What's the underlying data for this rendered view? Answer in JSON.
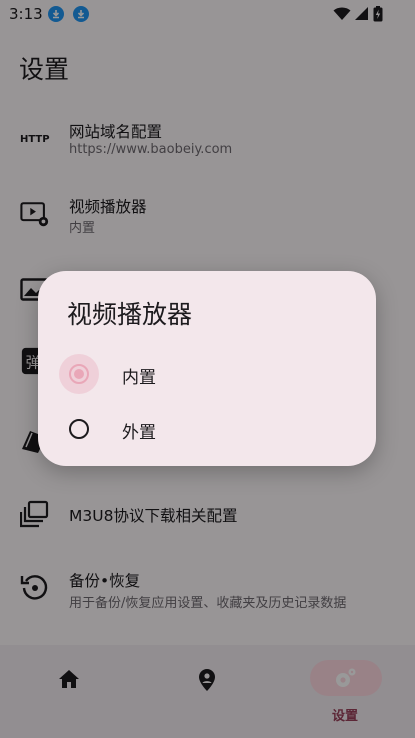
{
  "status_bar": {
    "time": "3:13"
  },
  "page": {
    "title": "设置"
  },
  "settings": [
    {
      "title": "网站域名配置",
      "subtitle": "https://www.baobeiy.com",
      "icon": "http-icon"
    },
    {
      "title": "视频播放器",
      "subtitle": "内置",
      "icon": "video-settings-icon"
    },
    {
      "title": "",
      "subtitle": "",
      "icon": "image-icon"
    },
    {
      "title": "",
      "subtitle": "",
      "icon": "danmaku-icon"
    },
    {
      "title": "",
      "subtitle": "",
      "icon": "cards-icon"
    },
    {
      "title": "M3U8协议下载相关配置",
      "subtitle": "",
      "icon": "library-icon"
    },
    {
      "title": "备份•恢复",
      "subtitle": "用于备份/恢复应用设置、收藏夹及历史记录数据",
      "icon": "restore-icon"
    }
  ],
  "bottom_nav": {
    "items": [
      {
        "icon": "home-icon",
        "label": ""
      },
      {
        "icon": "location-pin-icon",
        "label": ""
      },
      {
        "icon": "settings-icon",
        "label": "设置"
      }
    ]
  },
  "dialog": {
    "title": "视频播放器",
    "options": [
      {
        "label": "内置",
        "selected": true
      },
      {
        "label": "外置",
        "selected": false
      }
    ]
  },
  "colors": {
    "accent": "#99405a",
    "accent_light": "#e9a7b8",
    "dialog_bg": "#f3e7eb"
  }
}
